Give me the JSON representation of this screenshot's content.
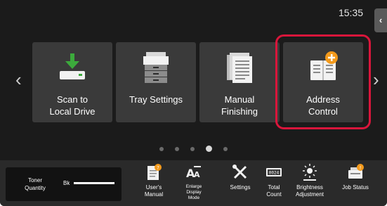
{
  "status": {
    "time": "15:35"
  },
  "home_tiles": [
    {
      "label": "Scan to\nLocal Drive",
      "icon": "scan-to-local-drive-icon"
    },
    {
      "label": "Tray Settings",
      "icon": "printer-tray-icon"
    },
    {
      "label": "Manual\nFinishing",
      "icon": "documents-stack-icon"
    },
    {
      "label": "Address\nControl",
      "icon": "address-book-add-icon"
    }
  ],
  "pagination": {
    "pages": 5,
    "current": 4
  },
  "toner": {
    "title": "Toner\nQuantity",
    "color_label": "Bk"
  },
  "bottom_items": [
    {
      "label": "User's\nManual",
      "icon": "user-manual-icon"
    },
    {
      "label": "Enlarge\nDisplay\nMode",
      "icon": "enlarge-display-icon"
    },
    {
      "label": "Settings",
      "icon": "settings-tools-icon"
    },
    {
      "label": "Total\nCount",
      "icon": "counter-icon"
    },
    {
      "label": "Brightness\nAdjustment",
      "icon": "brightness-icon"
    },
    {
      "label": "Job Status",
      "icon": "job-status-icon"
    }
  ],
  "colors": {
    "highlight": "#d9163b",
    "accent_orange": "#f39a1c",
    "accent_green": "#3caa3c"
  }
}
